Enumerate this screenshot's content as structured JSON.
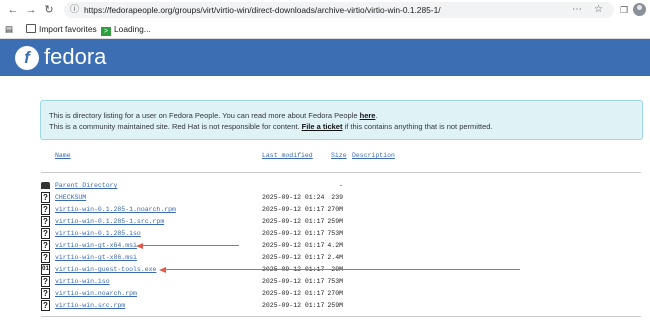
{
  "browser": {
    "url": "https://fedorapeople.org/groups/virt/virtio-win/direct-downloads/archive-virtio/virtio-win-0.1.285-1/",
    "bookmarks": [
      {
        "label": "Import favorites",
        "icon": "folder-icon"
      },
      {
        "label": "Loading...",
        "icon": "loading-icon"
      }
    ]
  },
  "header": {
    "logo_text": "fedora",
    "colors": {
      "brand": "#3c6eb4"
    }
  },
  "notice": {
    "line1_prefix": "This is directory listing for a user on Fedora People. You can read more about Fedora People ",
    "line1_link": "here",
    "line1_suffix": ".",
    "line2_prefix": "This is a community maintained site. Red Hat is not responsible for content. ",
    "line2_link": "File a ticket",
    "line2_suffix": " if this contains anything that is not permitted."
  },
  "listing": {
    "columns": {
      "name": "Name",
      "modified": "Last modified",
      "size": "Size",
      "description": "Description"
    },
    "parent": {
      "name": "Parent Directory",
      "size": "-"
    },
    "rows": [
      {
        "name": "CHECKSUM",
        "modified": "2025-09-12 01:24",
        "size": "239"
      },
      {
        "name": "virtio-win-0.1.285-1.noarch.rpm",
        "modified": "2025-09-12 01:17",
        "size": "270M"
      },
      {
        "name": "virtio-win-0.1.285-1.src.rpm",
        "modified": "2025-09-12 01:17",
        "size": "259M"
      },
      {
        "name": "virtio-win-0.1.285.iso",
        "modified": "2025-09-12 01:17",
        "size": "753M"
      },
      {
        "name": "virtio-win-gt-x64.msi",
        "modified": "2025-09-12 01:17",
        "size": "4.2M"
      },
      {
        "name": "virtio-win-gt-x86.msi",
        "modified": "2025-09-12 01:17",
        "size": "2.4M"
      },
      {
        "name": "virtio-win-guest-tools.exe",
        "modified": "2025-09-12 01:17",
        "size": "29M"
      },
      {
        "name": "virtio-win.iso",
        "modified": "2025-09-12 01:17",
        "size": "753M"
      },
      {
        "name": "virtio-win.noarch.rpm",
        "modified": "2025-09-12 01:17",
        "size": "270M"
      },
      {
        "name": "virtio-win.src.rpm",
        "modified": "2025-09-12 01:17",
        "size": "259M"
      }
    ],
    "annotation_color": "#e05a4a"
  }
}
